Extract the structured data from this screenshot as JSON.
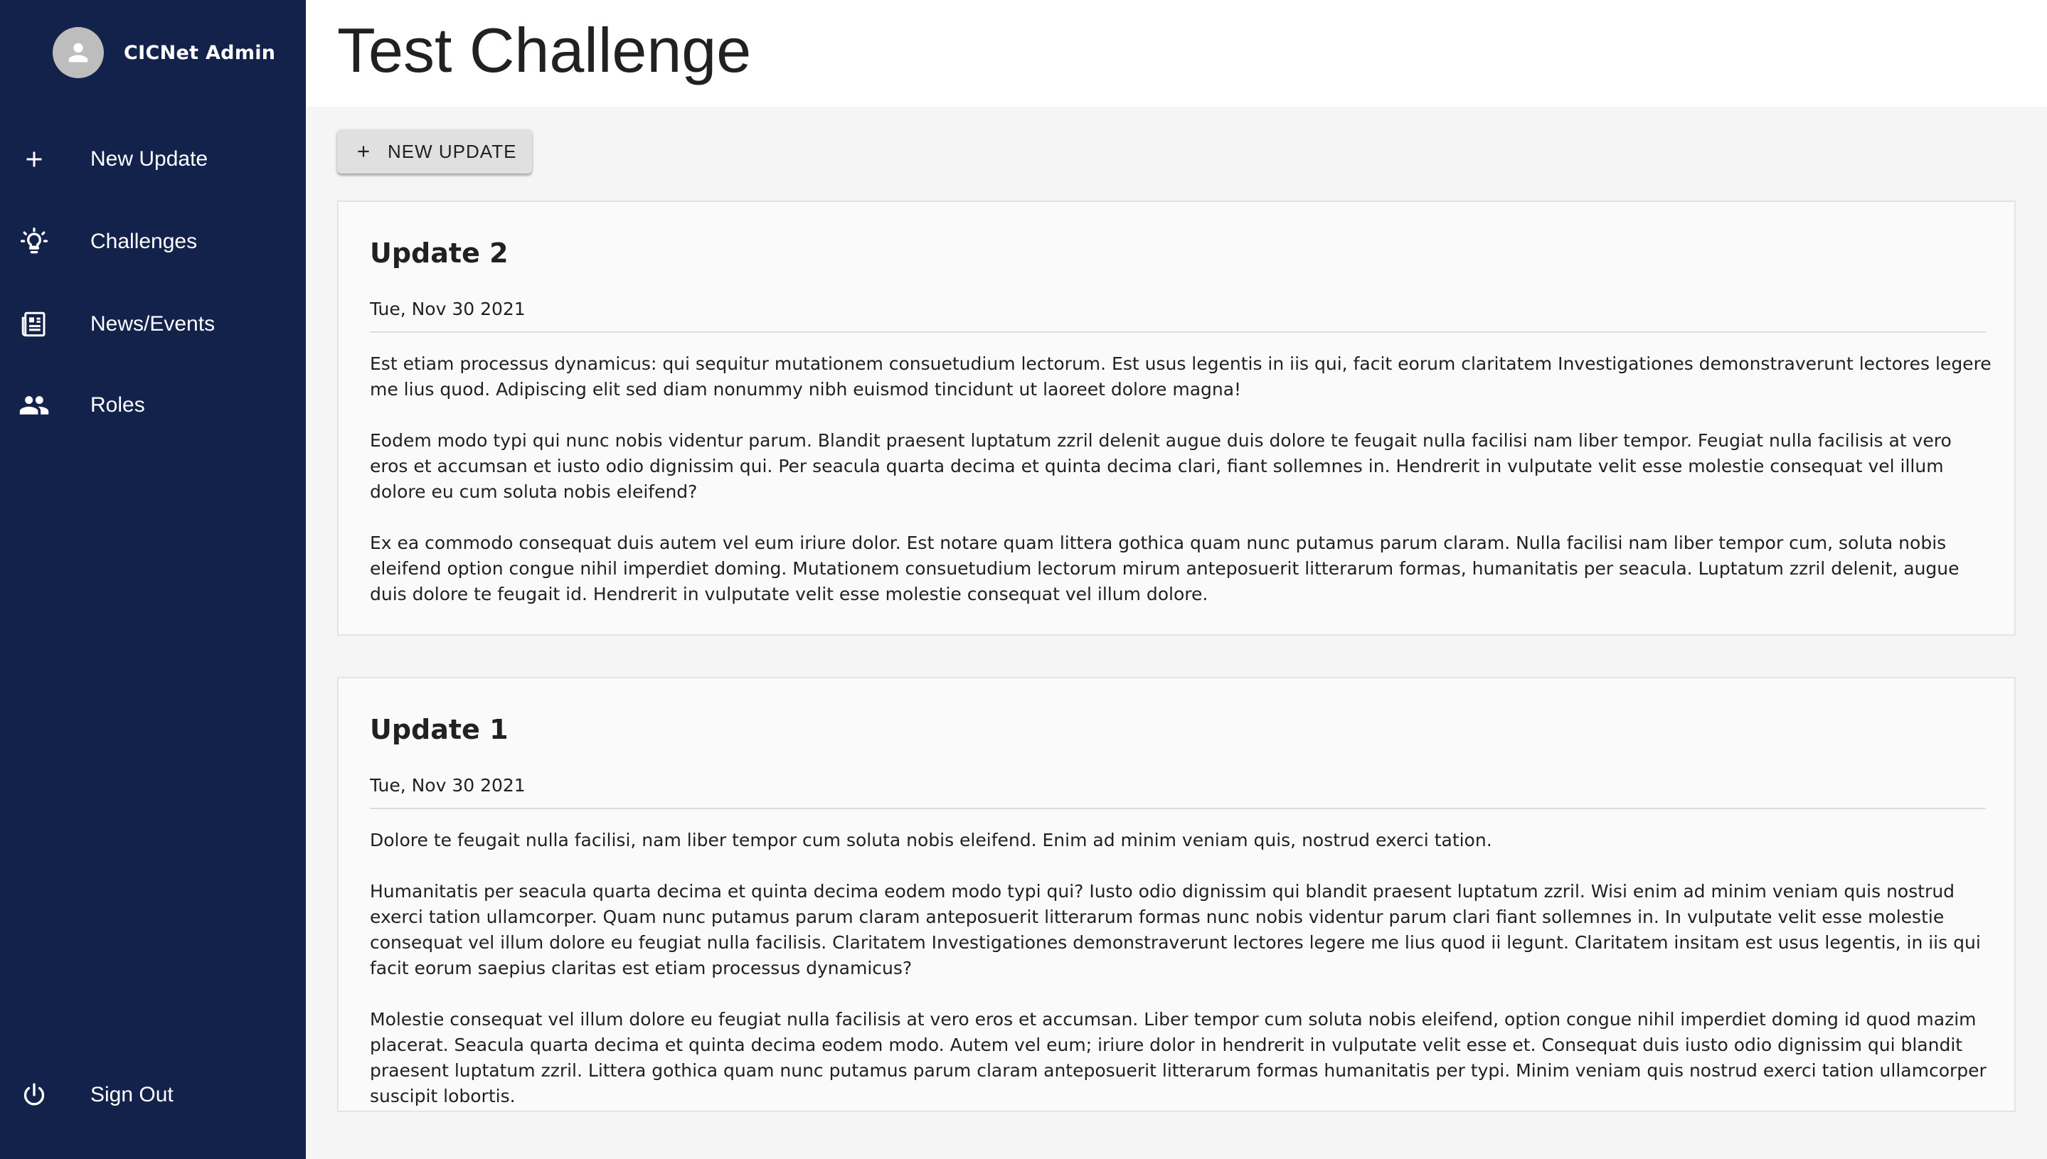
{
  "sidebar": {
    "user_name": "CICNet Admin",
    "items": [
      {
        "label": "New Update",
        "icon": "plus-icon"
      },
      {
        "label": "Challenges",
        "icon": "lightbulb-icon"
      },
      {
        "label": "News/Events",
        "icon": "newspaper-icon"
      },
      {
        "label": "Roles",
        "icon": "people-icon"
      }
    ],
    "sign_out": {
      "label": "Sign Out",
      "icon": "power-icon"
    }
  },
  "header": {
    "title": "Test Challenge"
  },
  "toolbar": {
    "new_update_label": "NEW UPDATE"
  },
  "updates": [
    {
      "title": "Update 2",
      "date": "Tue, Nov 30 2021",
      "paragraphs": [
        "Est etiam processus dynamicus: qui sequitur mutationem consuetudium lectorum. Est usus legentis in iis qui, facit eorum claritatem Investigationes demonstraverunt lectores legere me lius quod. Adipiscing elit sed diam nonummy nibh euismod tincidunt ut laoreet dolore magna!",
        "Eodem modo typi qui nunc nobis videntur parum. Blandit praesent luptatum zzril delenit augue duis dolore te feugait nulla facilisi nam liber tempor. Feugiat nulla facilisis at vero eros et accumsan et iusto odio dignissim qui. Per seacula quarta decima et quinta decima clari, fiant sollemnes in. Hendrerit in vulputate velit esse molestie consequat vel illum dolore eu cum soluta nobis eleifend?",
        "Ex ea commodo consequat duis autem vel eum iriure dolor. Est notare quam littera gothica quam nunc putamus parum claram. Nulla facilisi nam liber tempor cum, soluta nobis eleifend option congue nihil imperdiet doming. Mutationem consuetudium lectorum mirum anteposuerit litterarum formas, humanitatis per seacula. Luptatum zzril delenit, augue duis dolore te feugait id. Hendrerit in vulputate velit esse molestie consequat vel illum dolore."
      ]
    },
    {
      "title": "Update 1",
      "date": "Tue, Nov 30 2021",
      "paragraphs": [
        "Dolore te feugait nulla facilisi, nam liber tempor cum soluta nobis eleifend. Enim ad minim veniam quis, nostrud exerci tation.",
        "Humanitatis per seacula quarta decima et quinta decima eodem modo typi qui? Iusto odio dignissim qui blandit praesent luptatum zzril. Wisi enim ad minim veniam quis nostrud exerci tation ullamcorper. Quam nunc putamus parum claram anteposuerit litterarum formas nunc nobis videntur parum clari fiant sollemnes in. In vulputate velit esse molestie consequat vel illum dolore eu feugiat nulla facilisis. Claritatem Investigationes demonstraverunt lectores legere me lius quod ii legunt. Claritatem insitam est usus legentis, in iis qui facit eorum saepius claritas est etiam processus dynamicus?",
        "Molestie consequat vel illum dolore eu feugiat nulla facilisis at vero eros et accumsan. Liber tempor cum soluta nobis eleifend, option congue nihil imperdiet doming id quod mazim placerat. Seacula quarta decima et quinta decima eodem modo. Autem vel eum; iriure dolor in hendrerit in vulputate velit esse et. Consequat duis iusto odio dignissim qui blandit praesent luptatum zzril. Littera gothica quam nunc putamus parum claram anteposuerit litterarum formas humanitatis per typi. Minim veniam quis nostrud exerci tation ullamcorper suscipit lobortis."
      ]
    }
  ],
  "colors": {
    "sidebar_bg": "#13224a",
    "card_bg": "#fafafa",
    "button_bg": "#e0e0e0"
  }
}
